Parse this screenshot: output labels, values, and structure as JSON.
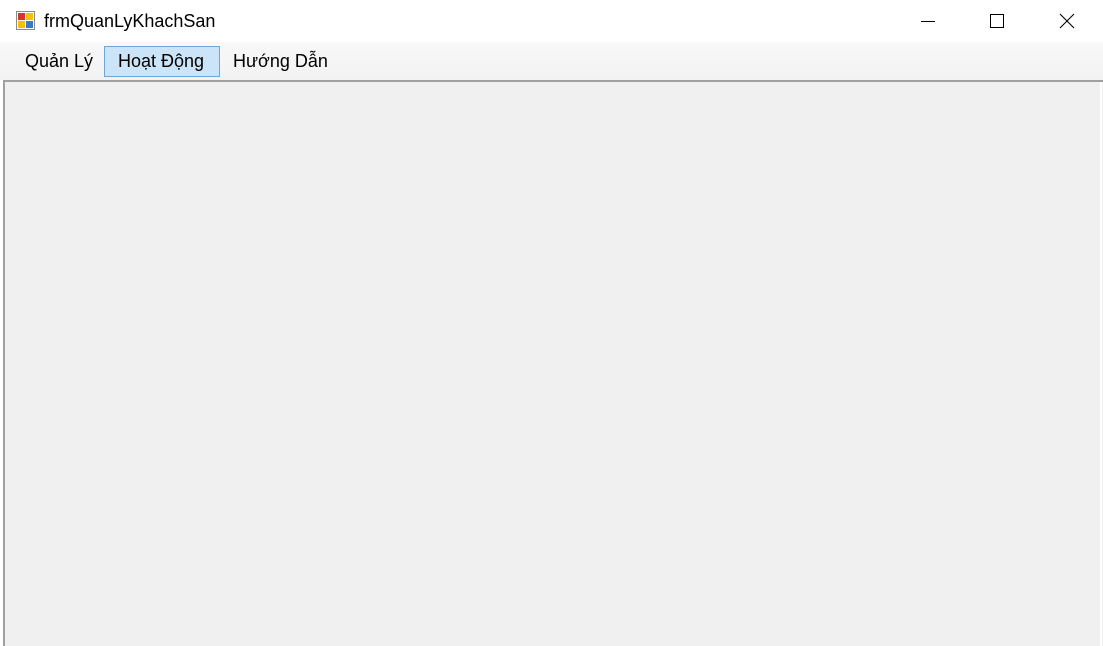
{
  "window": {
    "title": "frmQuanLyKhachSan",
    "icon": "app-form-icon"
  },
  "caption_buttons": {
    "minimize_icon": "minimize-icon",
    "maximize_icon": "maximize-icon",
    "close_icon": "close-icon"
  },
  "menu": {
    "items": [
      {
        "label": "Quản Lý"
      },
      {
        "label": "Hoạt Động",
        "selected": true
      },
      {
        "label": "Hướng Dẫn"
      }
    ]
  },
  "colors": {
    "client_background": "#f0f0f0",
    "menu_highlight": "#cce4f7",
    "menu_highlight_border": "#6ea6d8"
  }
}
